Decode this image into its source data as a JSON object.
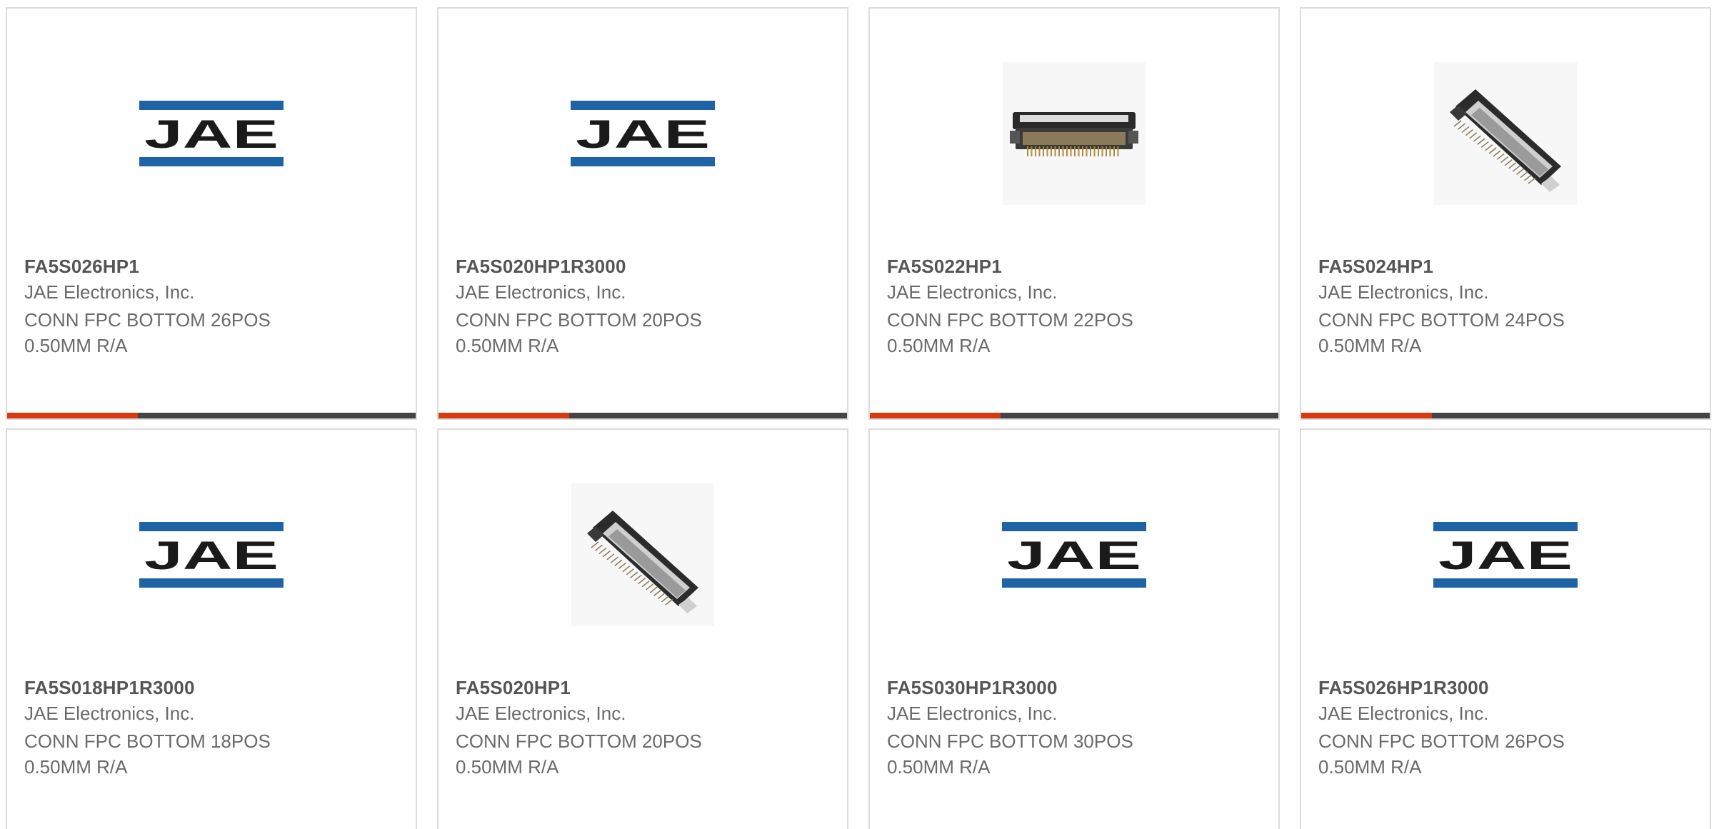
{
  "colors": {
    "bar_accent": "#d9390f",
    "bar_track": "#444444",
    "logo_blue": "#1d63a5",
    "logo_text": "#1a1a1a"
  },
  "products": [
    {
      "part_number": "FA5S026HP1",
      "manufacturer": "JAE Electronics, Inc.",
      "desc_line1": "CONN FPC BOTTOM 26POS",
      "desc_line2": "0.50MM R/A",
      "image": "jae-logo",
      "logo_text": "JAE",
      "progress": 0.32
    },
    {
      "part_number": "FA5S020HP1R3000",
      "manufacturer": "JAE Electronics, Inc.",
      "desc_line1": "CONN FPC BOTTOM 20POS",
      "desc_line2": "0.50MM R/A",
      "image": "jae-logo",
      "logo_text": "JAE",
      "progress": 0.32
    },
    {
      "part_number": "FA5S022HP1",
      "manufacturer": "JAE Electronics, Inc.",
      "desc_line1": "CONN FPC BOTTOM 22POS",
      "desc_line2": "0.50MM R/A",
      "image": "connector-front-photo",
      "progress": 0.32
    },
    {
      "part_number": "FA5S024HP1",
      "manufacturer": "JAE Electronics, Inc.",
      "desc_line1": "CONN FPC BOTTOM 24POS",
      "desc_line2": "0.50MM R/A",
      "image": "connector-angled-photo",
      "progress": 0.32
    },
    {
      "part_number": "FA5S018HP1R3000",
      "manufacturer": "JAE Electronics, Inc.",
      "desc_line1": "CONN FPC BOTTOM 18POS",
      "desc_line2": "0.50MM R/A",
      "image": "jae-logo",
      "logo_text": "JAE"
    },
    {
      "part_number": "FA5S020HP1",
      "manufacturer": "JAE Electronics, Inc.",
      "desc_line1": "CONN FPC BOTTOM 20POS",
      "desc_line2": "0.50MM R/A",
      "image": "connector-angled-photo"
    },
    {
      "part_number": "FA5S030HP1R3000",
      "manufacturer": "JAE Electronics, Inc.",
      "desc_line1": "CONN FPC BOTTOM 30POS",
      "desc_line2": "0.50MM R/A",
      "image": "jae-logo",
      "logo_text": "JAE"
    },
    {
      "part_number": "FA5S026HP1R3000",
      "manufacturer": "JAE Electronics, Inc.",
      "desc_line1": "CONN FPC BOTTOM 26POS",
      "desc_line2": "0.50MM R/A",
      "image": "jae-logo",
      "logo_text": "JAE"
    }
  ]
}
